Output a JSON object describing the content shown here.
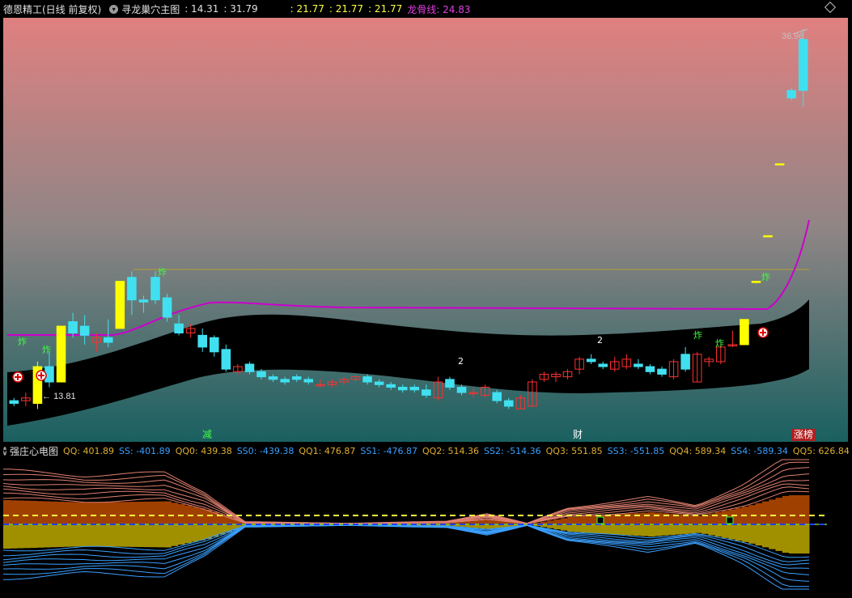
{
  "main_header": {
    "title": "德恩精工(日线 前复权)",
    "indicator_name": "寻龙巢穴主图",
    "values": [
      ": 14.31",
      ": 31.79",
      ": 21.77",
      ": 21.77",
      ": 21.77"
    ],
    "dragon_label": "龙骨线: 24.83"
  },
  "chart_annotations": {
    "high_price": "36.96",
    "low_price": "13.81",
    "zha_label": "炸",
    "two_label": "2",
    "bottom_tags": [
      "减",
      "财",
      "涨榜"
    ]
  },
  "sub_header": {
    "title": "强庄心电图",
    "items": [
      {
        "label": "QQ: 401.89",
        "color": "#e0b030"
      },
      {
        "label": "SS: -401.89",
        "color": "#3aa0ff"
      },
      {
        "label": "QQ0: 439.38",
        "color": "#e0b030"
      },
      {
        "label": "SS0: -439.38",
        "color": "#3aa0ff"
      },
      {
        "label": "QQ1: 476.87",
        "color": "#e0b030"
      },
      {
        "label": "SS1: -476.87",
        "color": "#3aa0ff"
      },
      {
        "label": "QQ2: 514.36",
        "color": "#e0b030"
      },
      {
        "label": "SS2: -514.36",
        "color": "#3aa0ff"
      },
      {
        "label": "QQ3: 551.85",
        "color": "#e0b030"
      },
      {
        "label": "SS3: -551.85",
        "color": "#3aa0ff"
      },
      {
        "label": "QQ4: 589.34",
        "color": "#e0b030"
      },
      {
        "label": "SS4: -589.34",
        "color": "#3aa0ff"
      },
      {
        "label": "QQ5: 626.84",
        "color": "#e0b030"
      }
    ]
  },
  "icons": [
    "dropdown-icon",
    "diamond-icon",
    "plus-circle-icon"
  ],
  "colors": {
    "up_candle": "#ff3030",
    "down_candle": "#40e0f0",
    "limit_up": "#ffff00",
    "dragon_line": "#cc00cc",
    "gradient_top": "#e08080",
    "gradient_bottom": "#1a6060"
  },
  "chart_data": {
    "type": "candlestick",
    "ohlc": [
      [
        14.3,
        14.4,
        14.1,
        14.2
      ],
      [
        14.3,
        14.6,
        14.1,
        14.4
      ],
      [
        14.2,
        15.8,
        14.0,
        15.6
      ],
      [
        15.6,
        16.2,
        14.8,
        15.0
      ],
      [
        15.0,
        17.3,
        15.0,
        17.3
      ],
      [
        17.5,
        17.9,
        16.8,
        17.0
      ],
      [
        17.3,
        17.8,
        16.5,
        16.9
      ],
      [
        16.6,
        17.0,
        16.2,
        16.8
      ],
      [
        16.8,
        17.6,
        16.4,
        16.6
      ],
      [
        17.2,
        19.4,
        17.2,
        19.4
      ],
      [
        19.6,
        19.9,
        17.8,
        18.5
      ],
      [
        18.5,
        18.7,
        17.9,
        18.4
      ],
      [
        19.6,
        19.9,
        18.3,
        18.5
      ],
      [
        18.6,
        18.8,
        17.5,
        17.7
      ],
      [
        17.4,
        17.8,
        16.9,
        17.0
      ],
      [
        17.0,
        17.4,
        16.8,
        17.2
      ],
      [
        16.9,
        17.2,
        16.2,
        16.4
      ],
      [
        16.8,
        16.9,
        16.0,
        16.2
      ],
      [
        16.3,
        16.5,
        15.4,
        15.5
      ],
      [
        15.4,
        15.7,
        15.3,
        15.6
      ],
      [
        15.7,
        15.8,
        15.3,
        15.4
      ],
      [
        15.4,
        15.5,
        15.1,
        15.2
      ],
      [
        15.2,
        15.3,
        15.0,
        15.1
      ],
      [
        15.1,
        15.2,
        14.9,
        15.0
      ],
      [
        15.2,
        15.3,
        15.0,
        15.1
      ],
      [
        15.1,
        15.2,
        14.9,
        15.0
      ],
      [
        14.9,
        15.1,
        14.8,
        14.9
      ],
      [
        14.9,
        15.1,
        14.8,
        15.0
      ],
      [
        15.0,
        15.2,
        14.9,
        15.1
      ],
      [
        15.1,
        15.3,
        15.0,
        15.2
      ],
      [
        15.2,
        15.3,
        14.9,
        15.0
      ],
      [
        15.0,
        15.1,
        14.8,
        14.9
      ],
      [
        14.9,
        15.0,
        14.7,
        14.8
      ],
      [
        14.8,
        14.9,
        14.6,
        14.7
      ],
      [
        14.8,
        14.9,
        14.6,
        14.7
      ],
      [
        14.7,
        14.9,
        14.4,
        14.5
      ],
      [
        14.4,
        15.2,
        14.3,
        15.0
      ],
      [
        15.1,
        15.2,
        14.7,
        14.8
      ],
      [
        14.8,
        14.9,
        14.5,
        14.6
      ],
      [
        14.6,
        14.8,
        14.4,
        14.6
      ],
      [
        14.5,
        14.9,
        14.4,
        14.8
      ],
      [
        14.6,
        14.7,
        14.2,
        14.3
      ],
      [
        14.3,
        14.4,
        14.0,
        14.1
      ],
      [
        14.0,
        14.5,
        14.0,
        14.4
      ],
      [
        14.1,
        15.1,
        14.1,
        15.0
      ],
      [
        15.1,
        15.4,
        15.0,
        15.3
      ],
      [
        15.2,
        15.4,
        15.0,
        15.3
      ],
      [
        15.2,
        15.5,
        15.1,
        15.4
      ],
      [
        15.5,
        16.0,
        15.3,
        15.9
      ],
      [
        15.9,
        16.1,
        15.7,
        15.8
      ],
      [
        15.7,
        15.8,
        15.5,
        15.6
      ],
      [
        15.5,
        16.0,
        15.4,
        15.8
      ],
      [
        15.6,
        16.1,
        15.5,
        15.9
      ],
      [
        15.7,
        15.9,
        15.5,
        15.6
      ],
      [
        15.6,
        15.7,
        15.3,
        15.4
      ],
      [
        15.5,
        15.6,
        15.2,
        15.3
      ],
      [
        15.2,
        15.9,
        15.1,
        15.8
      ],
      [
        16.1,
        16.4,
        15.4,
        15.5
      ],
      [
        15.0,
        16.2,
        15.0,
        16.1
      ],
      [
        15.8,
        16.0,
        15.6,
        15.9
      ],
      [
        15.8,
        16.5,
        15.7,
        16.4
      ],
      [
        16.5,
        17.1,
        16.4,
        16.5
      ],
      [
        16.5,
        17.6,
        16.5,
        17.6
      ],
      [
        19.4,
        19.4,
        19.3,
        19.4
      ],
      [
        21.8,
        21.8,
        21.8,
        21.8
      ],
      [
        26.2,
        26.2,
        26.2,
        26.2
      ],
      [
        31.6,
        31.8,
        30.8,
        31.0
      ],
      [
        36.0,
        37.0,
        30.3,
        31.6
      ]
    ]
  }
}
